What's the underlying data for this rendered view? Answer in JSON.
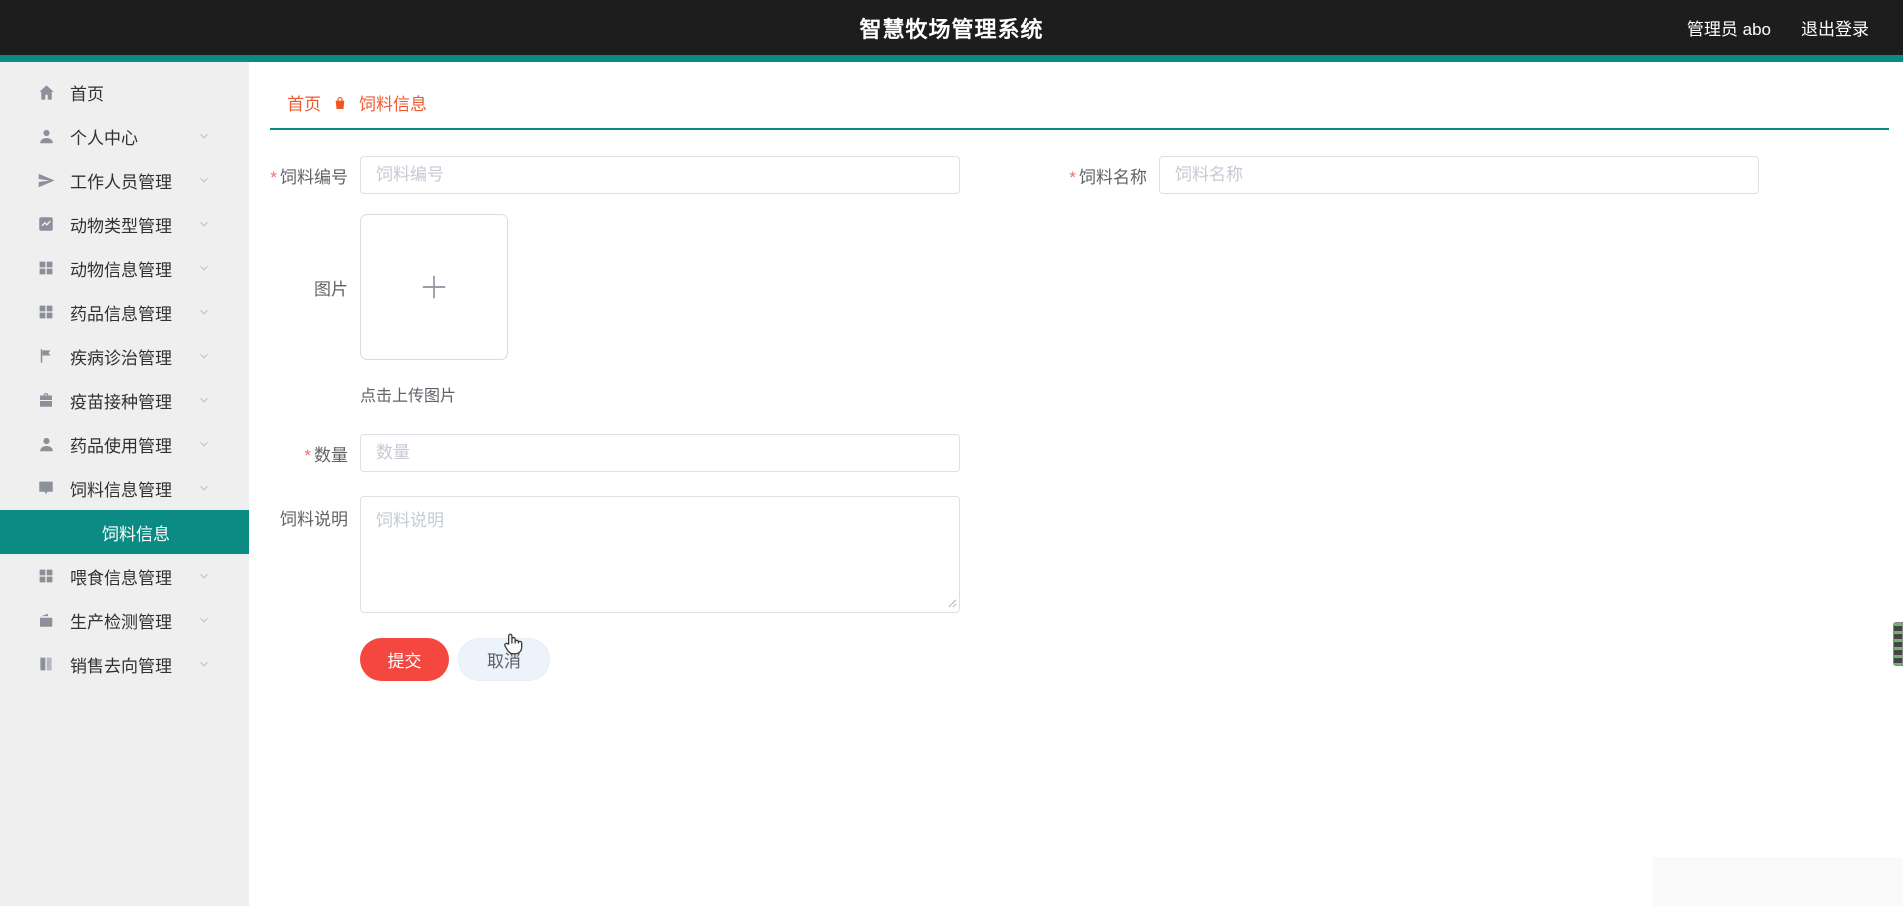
{
  "header": {
    "title": "智慧牧场管理系统",
    "username": "管理员 abo",
    "logout_label": "退出登录"
  },
  "sidebar": {
    "items": [
      {
        "label": "首页",
        "icon": "home-icon",
        "has_children": false
      },
      {
        "label": "个人中心",
        "icon": "user-icon",
        "has_children": true
      },
      {
        "label": "工作人员管理",
        "icon": "send-icon",
        "has_children": true
      },
      {
        "label": "动物类型管理",
        "icon": "chart-icon",
        "has_children": true
      },
      {
        "label": "动物信息管理",
        "icon": "grid-icon",
        "has_children": true
      },
      {
        "label": "药品信息管理",
        "icon": "grid-icon",
        "has_children": true
      },
      {
        "label": "疾病诊治管理",
        "icon": "flag-icon",
        "has_children": true
      },
      {
        "label": "疫苗接种管理",
        "icon": "briefcase-icon",
        "has_children": true
      },
      {
        "label": "药品使用管理",
        "icon": "user-icon",
        "has_children": true
      },
      {
        "label": "饲料信息管理",
        "icon": "chat-icon",
        "has_children": true
      },
      {
        "label": "喂食信息管理",
        "icon": "grid-icon",
        "has_children": true
      },
      {
        "label": "生产检测管理",
        "icon": "wallet-icon",
        "has_children": true
      },
      {
        "label": "销售去向管理",
        "icon": "book-icon",
        "has_children": true
      }
    ],
    "active_submenu": {
      "label": "饲料信息"
    }
  },
  "breadcrumb": {
    "home": "首页",
    "current": "饲料信息"
  },
  "form": {
    "required_marker": "*",
    "feed_no": {
      "label": "饲料编号",
      "placeholder": "饲料编号",
      "value": ""
    },
    "feed_name": {
      "label": "饲料名称",
      "placeholder": "饲料名称",
      "value": ""
    },
    "image": {
      "label": "图片",
      "upload_hint": "点击上传图片"
    },
    "quantity": {
      "label": "数量",
      "placeholder": "数量",
      "value": ""
    },
    "description": {
      "label": "饲料说明",
      "placeholder": "饲料说明",
      "value": ""
    },
    "submit_label": "提交",
    "cancel_label": "取消"
  },
  "colors": {
    "header_bg": "#1d1d1d",
    "accent_teal": "#0a8a82",
    "active_item_bg": "#0c8b84",
    "sidebar_bg": "#efefef",
    "breadcrumb_orange": "#ed5a31",
    "danger_red": "#f4473f",
    "icon_gray": "#8b909a"
  }
}
